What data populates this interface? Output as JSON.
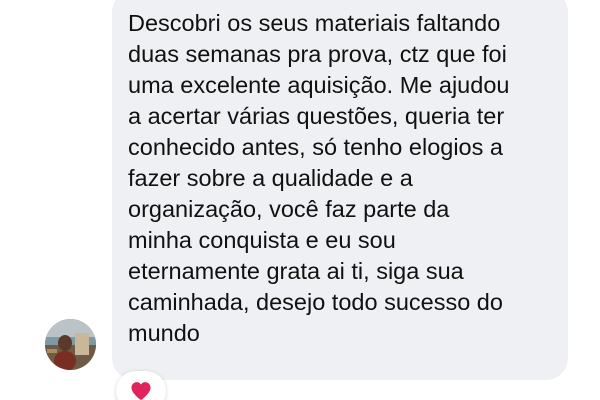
{
  "message": {
    "lines": [
      "Descobri os seus materiais faltando",
      "duas semanas pra prova, ctz que foi",
      "uma excelente aquisição. Me ajudou",
      "a acertar várias questões, queria ter",
      "conhecido antes, só tenho elogios a",
      "fazer sobre a qualidade e a",
      "organização, você faz parte da",
      "minha conquista e eu sou",
      "eternamente grata ai ti, siga sua",
      "caminhada, desejo todo sucesso do",
      "mundo"
    ],
    "bubble_color": "#eff0f3",
    "text_color": "#111111"
  },
  "sender": {
    "avatar_icon": "profile-photo"
  },
  "reaction": {
    "icon": "red-heart-icon",
    "color": "#e0245e"
  }
}
